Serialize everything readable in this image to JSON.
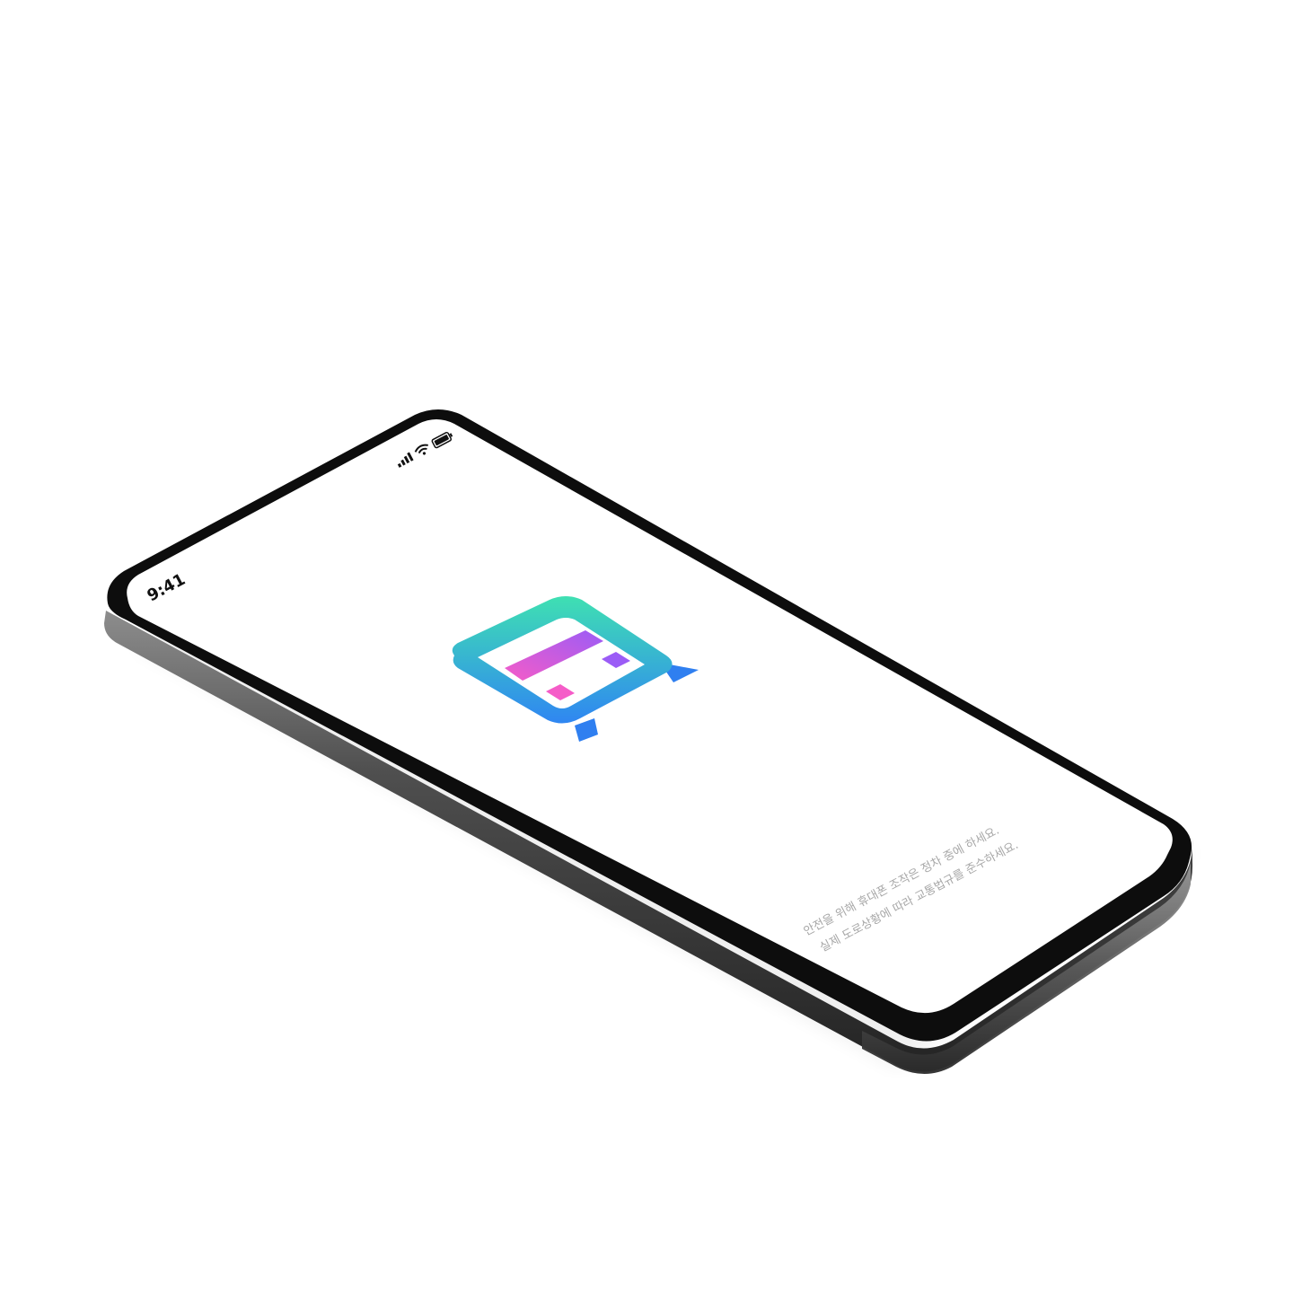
{
  "status_bar": {
    "time": "9:41",
    "signal_icon": "cellular-signal-icon",
    "wifi_icon": "wifi-icon",
    "battery_icon": "battery-icon"
  },
  "app": {
    "logo_icon": "app-logo-icon",
    "logo_colors": {
      "frame_top": "#3fe0b2",
      "frame_bottom": "#2f86f2",
      "bar_left": "#f55cc8",
      "bar_right": "#9b5cf6",
      "square_pink": "#f55cc8",
      "square_purple": "#9b5cf6",
      "tail": "#2f86f2"
    }
  },
  "safety_notice": {
    "line1": "안전을 위해 휴대폰 조작은 정차 중에 하세요.",
    "line2": "실제 도로상황에 따라 교통법규를 준수하세요."
  },
  "device": {
    "frame_color": "#2b2b2b",
    "screen_color": "#ffffff"
  }
}
